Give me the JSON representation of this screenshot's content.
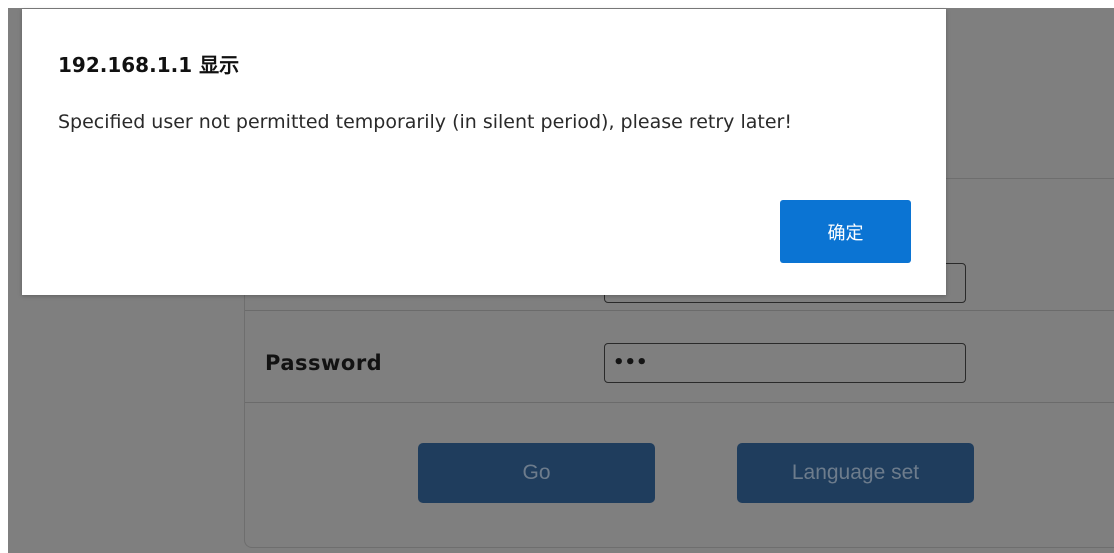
{
  "dialog": {
    "title": "192.168.1.1 显示",
    "message": "Specified user not permitted temporarily (in silent period), please retry later!",
    "ok_label": "确定"
  },
  "login": {
    "password_label": "Password",
    "username_value": "",
    "password_value": "•••",
    "go_label": "Go",
    "language_label": "Language set"
  },
  "colors": {
    "overlay": "#7f7f7f",
    "ok_button": "#0b74d3",
    "panel_button": "#1f3d5d"
  }
}
